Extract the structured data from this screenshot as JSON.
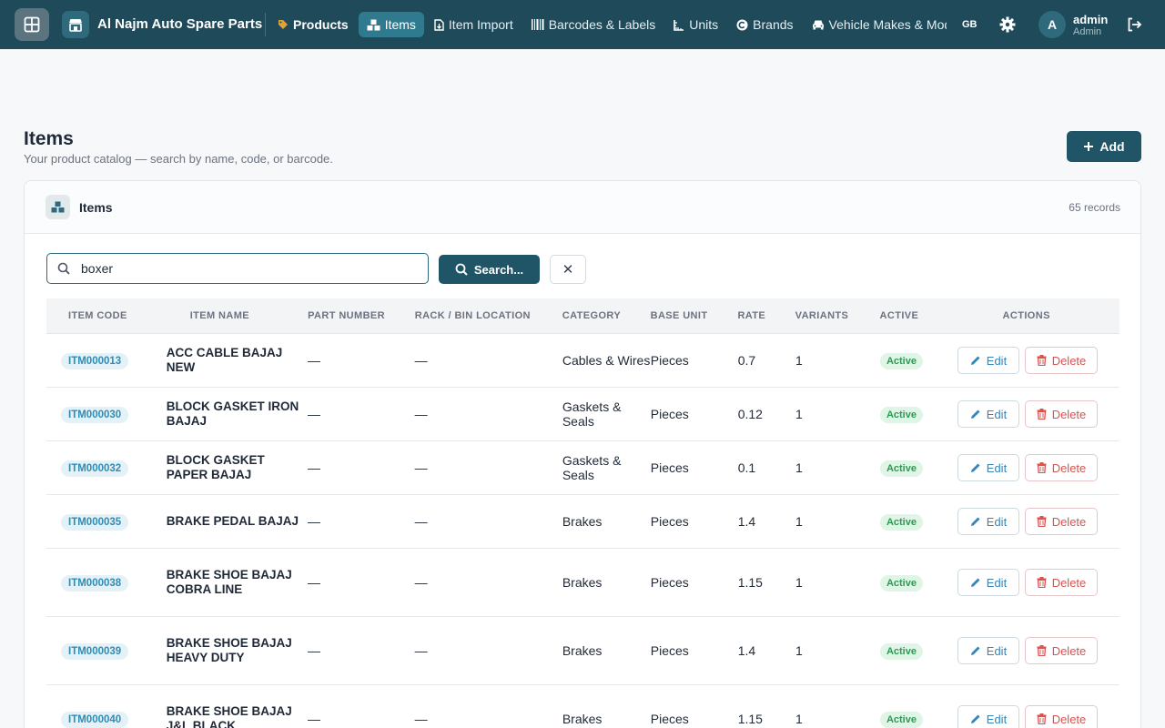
{
  "topbar": {
    "brand": "Al Najm Auto Spare Parts",
    "nav": [
      {
        "label": "Products",
        "icon": "tag-icon",
        "bold": true,
        "active": false
      },
      {
        "label": "Items",
        "icon": "boxes-icon",
        "bold": false,
        "active": true
      },
      {
        "label": "Item Import",
        "icon": "file-import-icon",
        "bold": false,
        "active": false
      },
      {
        "label": "Barcodes & Labels",
        "icon": "barcode-icon",
        "bold": false,
        "active": false
      },
      {
        "label": "Units",
        "icon": "ruler-icon",
        "bold": false,
        "active": false
      },
      {
        "label": "Brands",
        "icon": "copyright-icon",
        "bold": false,
        "active": false
      },
      {
        "label": "Vehicle Makes & Models",
        "icon": "car-icon",
        "bold": false,
        "active": false
      }
    ],
    "lang": "GB",
    "user": {
      "initial": "A",
      "name": "admin",
      "role": "Admin"
    }
  },
  "header": {
    "title": "Items",
    "subtitle": "Your product catalog — search by name, code, or barcode.",
    "add_label": "Add"
  },
  "card": {
    "title": "Items",
    "records": "65 records"
  },
  "search": {
    "value": "boxer",
    "button": "Search...",
    "clear": "✕"
  },
  "table": {
    "columns": [
      "ITEM CODE",
      "ITEM NAME",
      "PART NUMBER",
      "RACK / BIN LOCATION",
      "CATEGORY",
      "BASE UNIT",
      "RATE",
      "VARIANTS",
      "ACTIVE",
      "ACTIONS"
    ],
    "edit_label": "Edit",
    "delete_label": "Delete",
    "rows": [
      {
        "code": "ITM000013",
        "name": "ACC CABLE BAJAJ NEW",
        "part": "—",
        "rack": "—",
        "category": "Cables & Wires",
        "unit": "Pieces",
        "rate": "0.7",
        "variants": "1",
        "active": "Active"
      },
      {
        "code": "ITM000030",
        "name": "BLOCK GASKET IRON BAJAJ",
        "part": "—",
        "rack": "—",
        "category": "Gaskets & Seals",
        "unit": "Pieces",
        "rate": "0.12",
        "variants": "1",
        "active": "Active"
      },
      {
        "code": "ITM000032",
        "name": "BLOCK GASKET PAPER BAJAJ",
        "part": "—",
        "rack": "—",
        "category": "Gaskets & Seals",
        "unit": "Pieces",
        "rate": "0.1",
        "variants": "1",
        "active": "Active"
      },
      {
        "code": "ITM000035",
        "name": "BRAKE PEDAL BAJAJ",
        "part": "—",
        "rack": "—",
        "category": "Brakes",
        "unit": "Pieces",
        "rate": "1.4",
        "variants": "1",
        "active": "Active"
      },
      {
        "code": "ITM000038",
        "name": "BRAKE SHOE BAJAJ COBRA LINE",
        "part": "—",
        "rack": "—",
        "category": "Brakes",
        "unit": "Pieces",
        "rate": "1.15",
        "variants": "1",
        "active": "Active"
      },
      {
        "code": "ITM000039",
        "name": "BRAKE SHOE BAJAJ HEAVY DUTY",
        "part": "—",
        "rack": "—",
        "category": "Brakes",
        "unit": "Pieces",
        "rate": "1.4",
        "variants": "1",
        "active": "Active"
      },
      {
        "code": "ITM000040",
        "name": "BRAKE SHOE BAJAJ J&L BLACK",
        "part": "—",
        "rack": "—",
        "category": "Brakes",
        "unit": "Pieces",
        "rate": "1.15",
        "variants": "1",
        "active": "Active"
      }
    ]
  }
}
